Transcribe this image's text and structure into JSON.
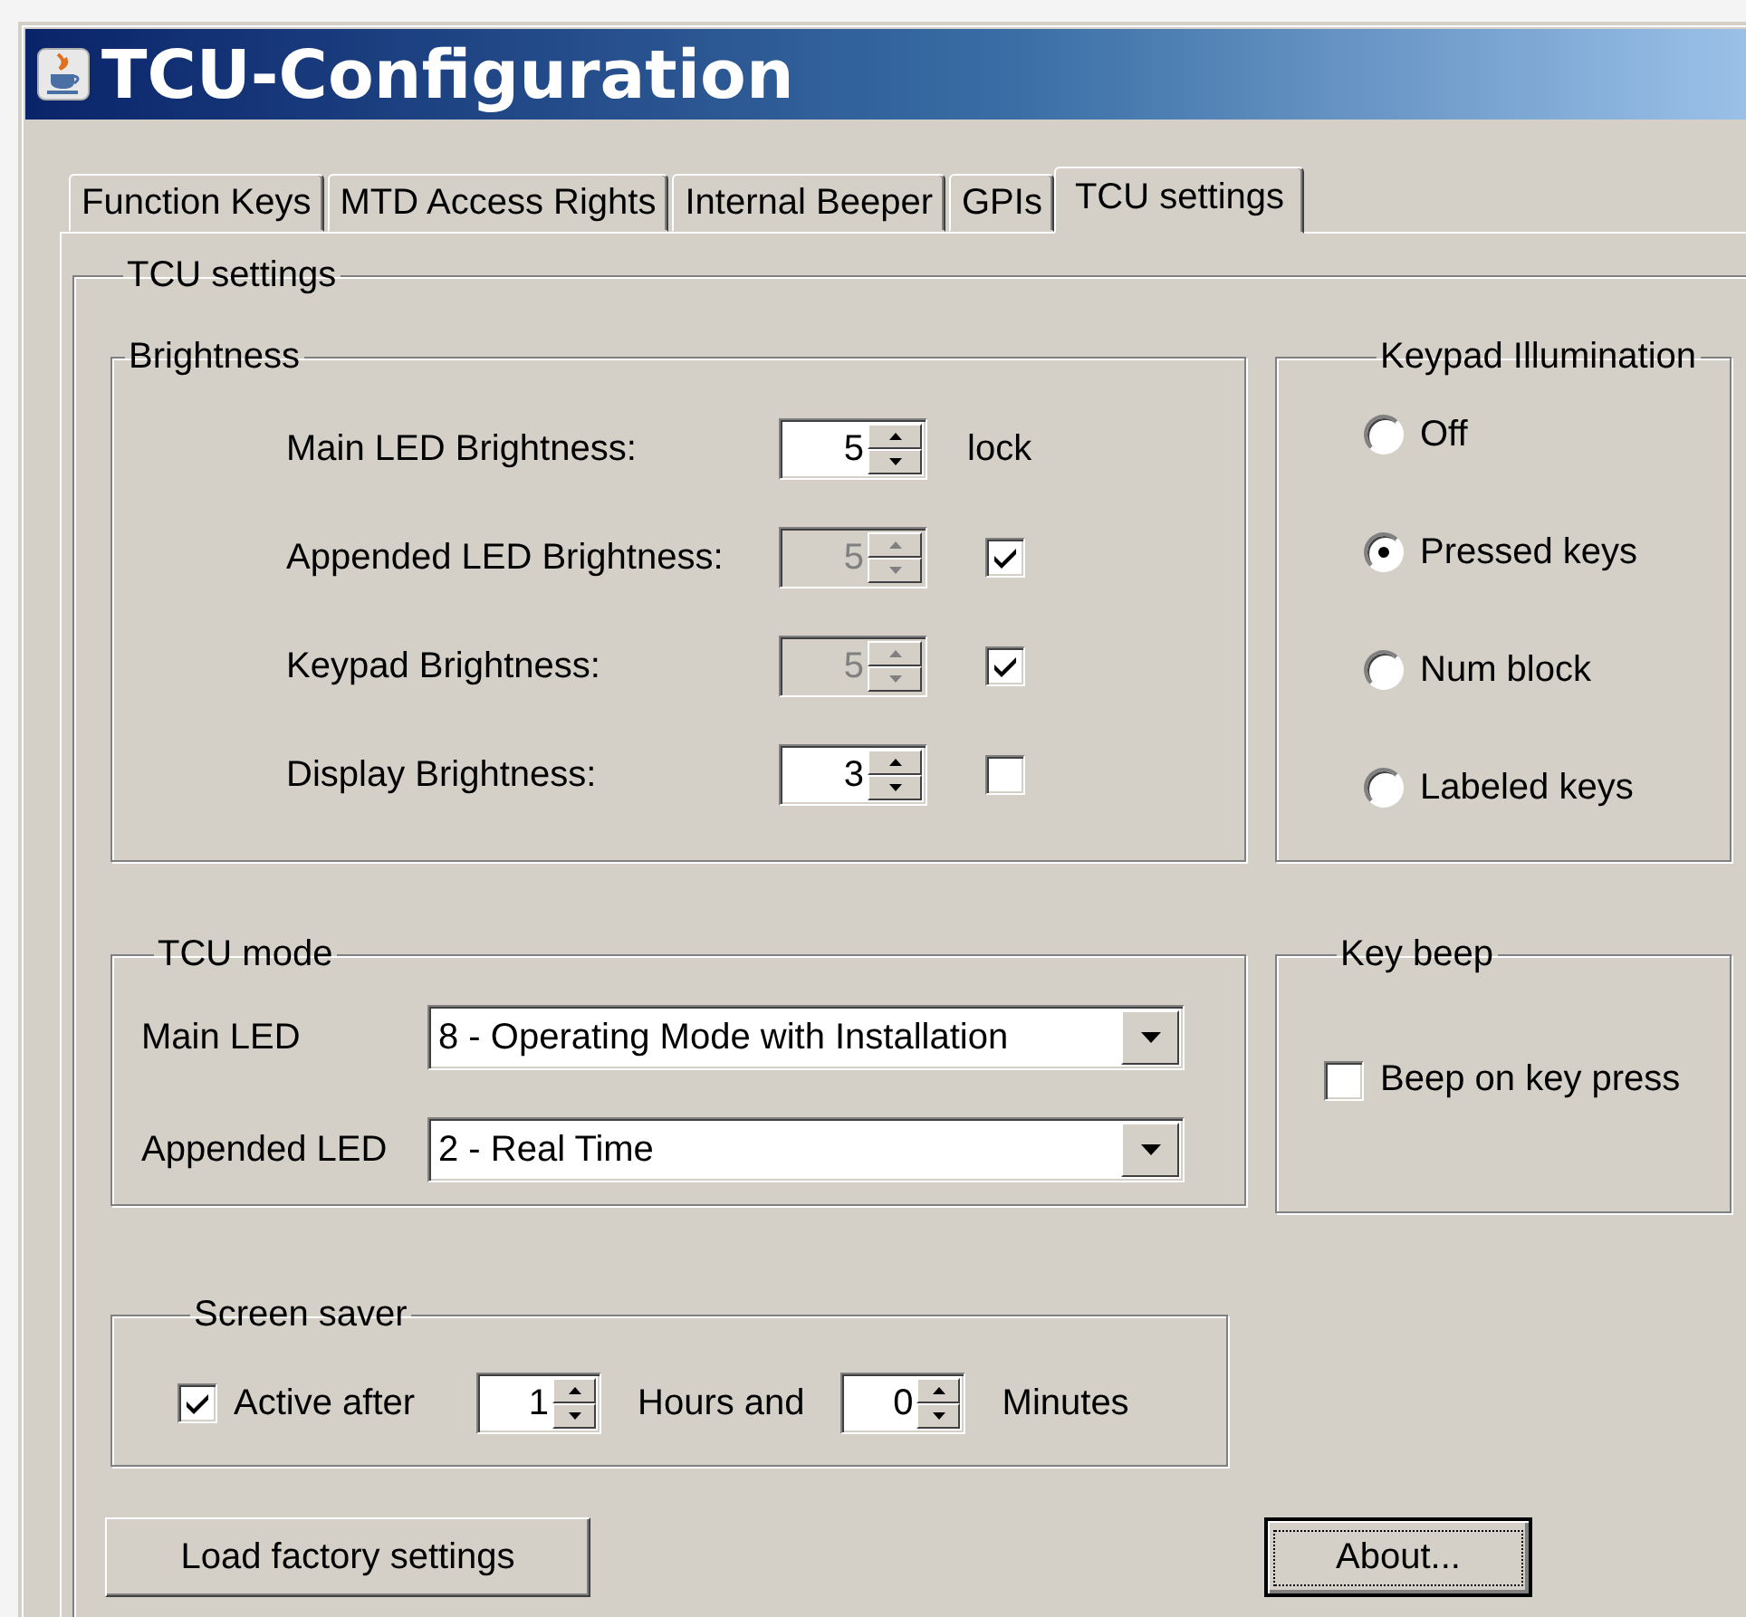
{
  "window": {
    "title": "TCU-Configuration"
  },
  "tabs": [
    {
      "label": "Function Keys",
      "selected": false
    },
    {
      "label": "MTD Access Rights",
      "selected": false
    },
    {
      "label": "Internal Beeper",
      "selected": false
    },
    {
      "label": "GPIs",
      "selected": false
    },
    {
      "label": "TCU settings",
      "selected": true
    }
  ],
  "panel": {
    "title": "TCU settings"
  },
  "brightness": {
    "title": "Brightness",
    "rows": [
      {
        "label": "Main LED Brightness:",
        "value": "5",
        "disabled": false,
        "kind": "note",
        "note": "lock"
      },
      {
        "label": "Appended LED Brightness:",
        "value": "5",
        "disabled": true,
        "kind": "checkbox",
        "checked": true
      },
      {
        "label": "Keypad Brightness:",
        "value": "5",
        "disabled": true,
        "kind": "checkbox",
        "checked": true
      },
      {
        "label": "Display Brightness:",
        "value": "3",
        "disabled": false,
        "kind": "checkbox",
        "checked": false
      }
    ]
  },
  "keypad_illumination": {
    "title": "Keypad Illumination",
    "options": [
      {
        "label": "Off",
        "selected": false
      },
      {
        "label": "Pressed keys",
        "selected": true
      },
      {
        "label": "Num block",
        "selected": false
      },
      {
        "label": "Labeled keys",
        "selected": false
      }
    ]
  },
  "tcu_mode": {
    "title": "TCU mode",
    "rows": [
      {
        "label": "Main LED",
        "value": "8 - Operating Mode with Installation"
      },
      {
        "label": "Appended LED",
        "value": "2 - Real Time"
      }
    ]
  },
  "key_beep": {
    "title": "Key beep",
    "checkbox": {
      "label": "Beep on key press",
      "checked": false
    }
  },
  "screen_saver": {
    "title": "Screen saver",
    "checkbox": {
      "label": "Active after",
      "checked": true
    },
    "hours": "1",
    "hours_label": "Hours and",
    "minutes": "0",
    "minutes_label": "Minutes"
  },
  "buttons": [
    {
      "label": "Load factory settings",
      "focused": false
    },
    {
      "label": "About...",
      "focused": true
    }
  ]
}
